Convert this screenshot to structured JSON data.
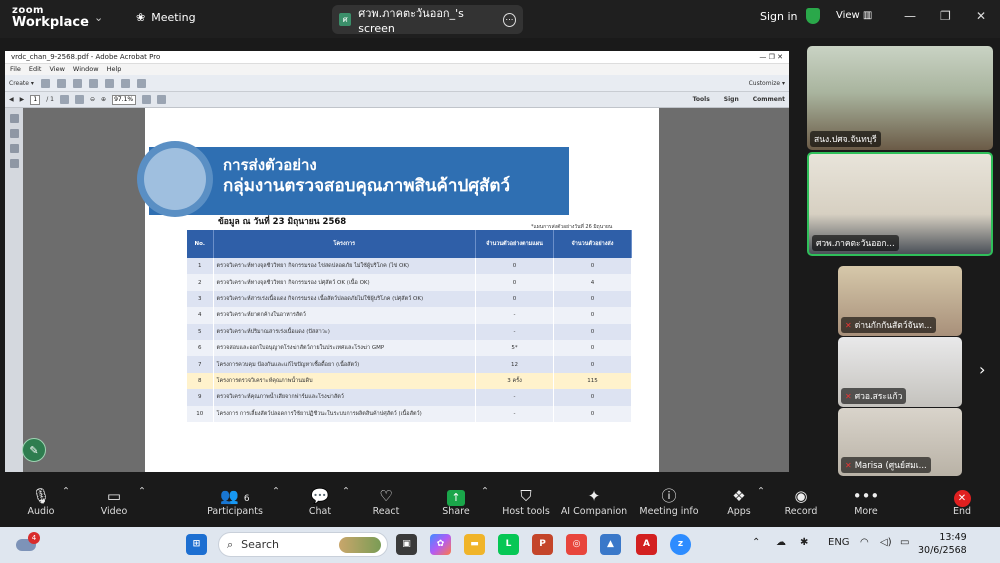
{
  "topbar": {
    "logo_line1": "zoom",
    "logo_line2": "Workplace",
    "meeting_label": "Meeting",
    "screen_share_title": "ศวพ.ภาคตะวันออก_'s screen",
    "screen_share_badge": "ศ",
    "sign_in": "Sign in",
    "view": "View"
  },
  "acrobat": {
    "window_title": "vrdc_chan_9-2568.pdf - Adobe Acrobat Pro",
    "menu": [
      "File",
      "Edit",
      "View",
      "Window",
      "Help"
    ],
    "create_label": "Create",
    "customize_label": "Customize",
    "page_current": "1",
    "page_total": "/ 1",
    "zoom_value": "97.1%",
    "tools_labels": [
      "Tools",
      "Sign",
      "Comment"
    ]
  },
  "document": {
    "title_line1": "การส่งตัวอย่าง",
    "title_line2": "กลุ่มงานตรวจสอบคุณภาพสินค้าปศุสัตว์",
    "data_date": "ข้อมูล ณ วันที่ 23 มิถุนายน 2568",
    "note": "*แผนการส่งตัวอย่างวันที่ 26 มิถุนายน",
    "table_headers": [
      "No.",
      "โครงการ",
      "จำนวนตัวอย่างตามแผน",
      "จำนวนตัวอย่างส่ง"
    ],
    "rows": [
      {
        "no": "1",
        "project": "ตรวจวิเคราะห์ทางจุลชีววิทยา กิจกรรมรอง ไข่สดปลอดภัย ไม่ใช้ผู้บริโภค (ไข่ OK)",
        "plan": "0",
        "sent": "0"
      },
      {
        "no": "2",
        "project": "ตรวจวิเคราะห์ทางจุลชีววิทยา กิจกรรมรอง ปศุสัตว์ OK (เนื้อ OK)",
        "plan": "0",
        "sent": "4"
      },
      {
        "no": "3",
        "project": "ตรวจวิเคราะห์สารเร่งเนื้อแดง กิจกรรมรอง เนื้อสัตว์ปลอดภัยไม่ใช้ผู้บริโภค (ปศุสัตว์ OK)",
        "plan": "0",
        "sent": "0"
      },
      {
        "no": "4",
        "project": "ตรวจวิเคราะห์ยาตกค้างในอาหารสัตว์",
        "plan": "-",
        "sent": "0"
      },
      {
        "no": "5",
        "project": "ตรวจวิเคราะห์ปริมาณสารเร่งเนื้อแดง (ปัสสาวะ)",
        "plan": "-",
        "sent": "0"
      },
      {
        "no": "6",
        "project": "ตรวจสอบและออกใบอนุญาตโรงฆ่าสัตว์ภายในประเทศและโรงฆ่า GMP",
        "plan": "5*",
        "sent": "0"
      },
      {
        "no": "7",
        "project": "โครงการควบคุม ป้องกันและแก้ไขปัญหาเชื้อดื้อยา (เนื้อสัตว์)",
        "plan": "12",
        "sent": "0"
      },
      {
        "no": "8",
        "project": "โครงการตรวจวิเคราะห์คุณภาพน้ำนมดิบ",
        "plan": "3 ครั้ง",
        "sent": "115"
      },
      {
        "no": "9",
        "project": "ตรวจวิเคราะห์คุณภาพน้ำเสียจากฟาร์มและโรงฆ่าสัตว์",
        "plan": "-",
        "sent": "0"
      },
      {
        "no": "10",
        "project": "โครงการ การเลี้ยงสัตว์ปลอดการใช้ยาปฏิชีวนะในระบบการผลิตสินค้าปศุสัตว์ (เนื้อสัตว์)",
        "plan": "-",
        "sent": "0"
      }
    ],
    "highlight_row_index": 7
  },
  "participants_panel": [
    {
      "name": "สนง.ปศจ.จันทบุรี",
      "muted": false
    },
    {
      "name": "ศวพ.ภาคตะวันออก...",
      "muted": false
    },
    {
      "name": "ด่านกักกันสัตว์จันท...",
      "muted": true
    },
    {
      "name": "ศวอ.สระแก้ว",
      "muted": true
    },
    {
      "name": "Marisa (ศูนย์สมเ...",
      "muted": true
    }
  ],
  "toolbar": {
    "audio": "Audio",
    "video": "Video",
    "participants": "Participants",
    "participants_count": "6",
    "chat": "Chat",
    "react": "React",
    "share": "Share",
    "host_tools": "Host tools",
    "ai_companion": "AI Companion",
    "meeting_info": "Meeting info",
    "apps": "Apps",
    "record": "Record",
    "more": "More",
    "end": "End"
  },
  "taskbar": {
    "search_placeholder": "Search",
    "weather_badge": "4",
    "lang": "ENG",
    "time": "13:49",
    "date": "30/6/2568"
  },
  "colors": {
    "banner_blue": "#2f6fb2",
    "table_header": "#2f5fa8",
    "highlight_row": "#fff2cc",
    "active_speaker_border": "#2fbf5a",
    "end_red": "#e02020"
  }
}
